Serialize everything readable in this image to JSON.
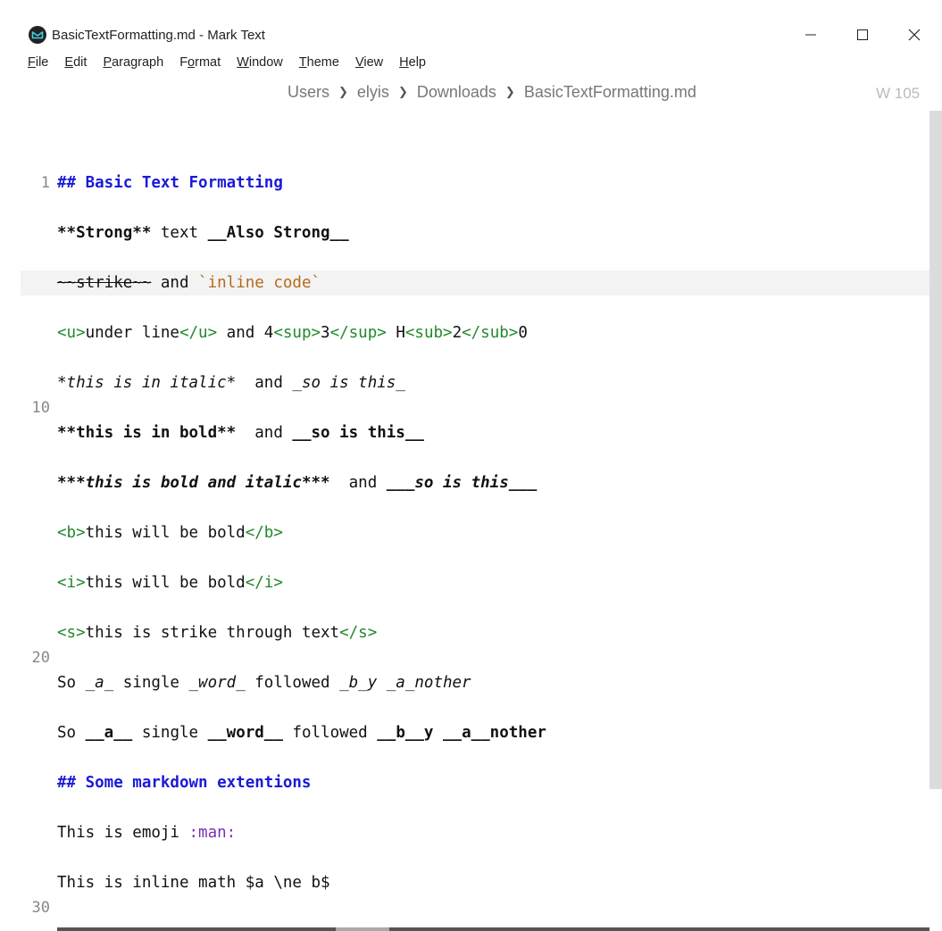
{
  "window": {
    "title": "BasicTextFormatting.md - Mark Text"
  },
  "menu": {
    "items": [
      {
        "ul": "F",
        "rest": "ile"
      },
      {
        "ul": "E",
        "rest": "dit"
      },
      {
        "ul": "P",
        "rest": "aragraph"
      },
      {
        "ul": "Fo",
        "rest": "rmat",
        "pre": "F",
        "mid": "o",
        "post": "rmat"
      },
      {
        "ul": "W",
        "rest": "indow"
      },
      {
        "ul": "T",
        "rest": "heme"
      },
      {
        "ul": "V",
        "rest": "iew"
      },
      {
        "ul": "H",
        "rest": "elp"
      }
    ]
  },
  "breadcrumb": [
    "Users",
    "elyis",
    "Downloads",
    "BasicTextFormatting.md"
  ],
  "word_count": "W 105",
  "gutter": [
    "1",
    "10",
    "20",
    "30"
  ],
  "lines": {
    "l1": {
      "a": "## Basic Text Formatting"
    },
    "l2": {
      "a": "**Strong**",
      "b": " text ",
      "c": "__Also Strong__"
    },
    "l3": {
      "a": "~~strike~~",
      "b": " and ",
      "c": "`inline code`"
    },
    "l4": {
      "t1": "<u>",
      "a": "under line",
      "t2": "</u>",
      "b": " and 4",
      "t3": "<sup>",
      "c": "3",
      "t4": "</sup>",
      "d": " H",
      "t5": "<sub>",
      "e": "2",
      "t6": "</sub>",
      "f": "0"
    },
    "l5": {
      "a": "*this is in italic*",
      "b": "  and ",
      "c": "_so is this_"
    },
    "l6": {
      "a": "**this is in bold**",
      "b": "  and ",
      "c": "__so is this__"
    },
    "l7": {
      "a": "***",
      "b": "this is bold and italic",
      "c": "***",
      "d": "  and ",
      "e": "___",
      "f": "so is this",
      "g": "___"
    },
    "l8": {
      "t1": "<b>",
      "a": "this will be bold",
      "t2": "</b>"
    },
    "l9": {
      "t1": "<i>",
      "a": "this will be bold",
      "t2": "</i>"
    },
    "l10": {
      "t1": "<s>",
      "a": "this is strike through text",
      "t2": "</s>"
    },
    "l11": {
      "a": "So ",
      "b": "_a_",
      "c": " single ",
      "d": "_word_",
      "e": " followed ",
      "f": "_b_y _a_nother"
    },
    "l12": {
      "a": "So ",
      "b": "__a__",
      "c": " single ",
      "d": "__word__",
      "e": " followed ",
      "f": "__b__y __a__nother"
    },
    "l13": {
      "a": "## Some markdown extentions"
    },
    "l14": {
      "a": "This is emoji ",
      "b": ":man:"
    },
    "l15": {
      "a": "This is inline math $a \\ne b$"
    }
  }
}
